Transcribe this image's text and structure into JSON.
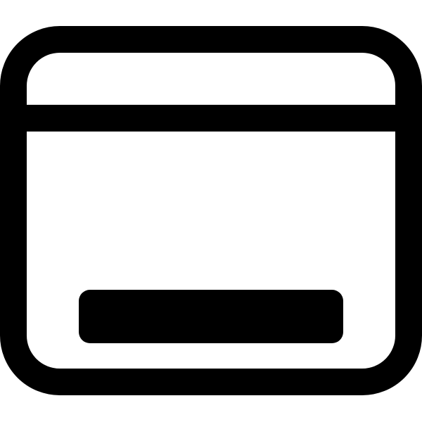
{
  "icon": {
    "name": "browser-window-icon",
    "stroke_color": "#000000",
    "fill_color": "#000000",
    "background_color": "#ffffff"
  }
}
